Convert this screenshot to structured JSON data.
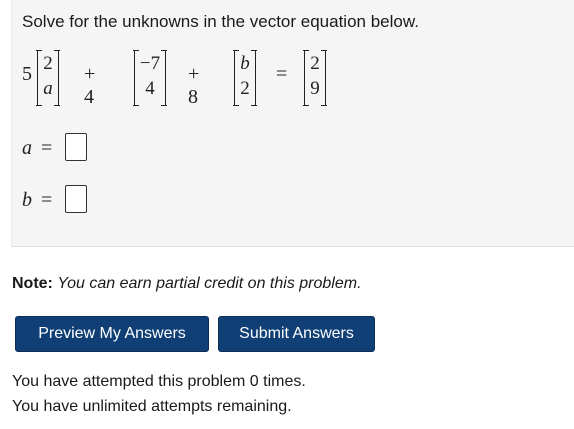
{
  "problem": {
    "prompt": "Solve for the unknowns in the vector equation below.",
    "equation": {
      "coef1": "5",
      "vec1": [
        "2",
        "a"
      ],
      "op1": "+ 4",
      "vec2": [
        "−7",
        "4"
      ],
      "op2": "+ 8",
      "vec3": [
        "b",
        "2"
      ],
      "equals": "=",
      "vec4": [
        "2",
        "9"
      ]
    },
    "answers": [
      {
        "label": "a",
        "equals": "=",
        "value": ""
      },
      {
        "label": "b",
        "equals": "=",
        "value": ""
      }
    ]
  },
  "note": {
    "prefix": "Note:",
    "text": "You can earn partial credit on this problem."
  },
  "buttons": {
    "preview": "Preview My Answers",
    "submit": "Submit Answers"
  },
  "status": {
    "attempts": "You have attempted this problem 0 times.",
    "remaining": "You have unlimited attempts remaining."
  }
}
